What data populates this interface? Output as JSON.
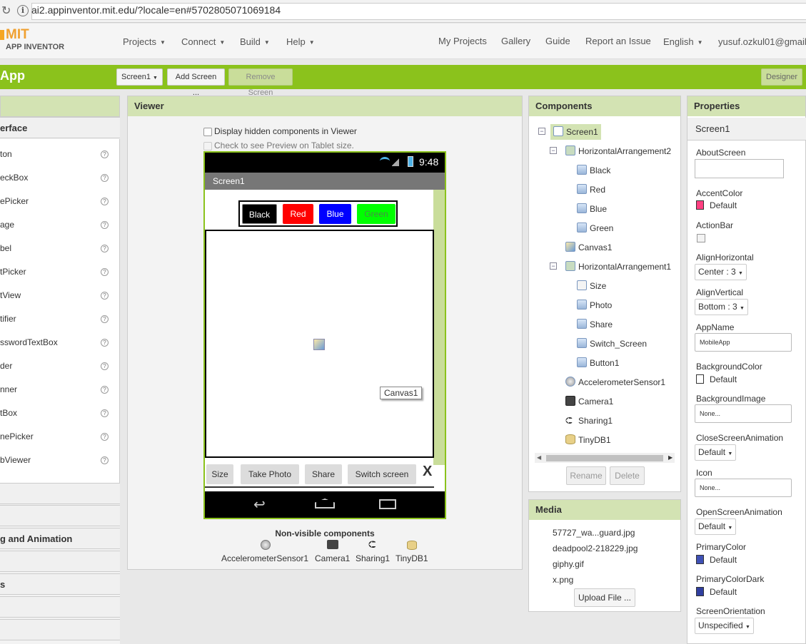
{
  "browser": {
    "url": "ai2.appinventor.mit.edu/?locale=en#5702805071069184"
  },
  "header": {
    "logo_mit": "MIT",
    "logo_sub": "APP INVENTOR",
    "menu_left": [
      "Projects",
      "Connect",
      "Build",
      "Help"
    ],
    "menu_right": [
      "My Projects",
      "Gallery",
      "Guide",
      "Report an Issue",
      "English",
      "yusuf.ozkul01@gmail."
    ]
  },
  "toolbar": {
    "app_title": "App",
    "screen_select": "Screen1",
    "add_screen": "Add Screen ...",
    "remove_screen": "Remove Screen",
    "designer": "Designer"
  },
  "palette": {
    "section_ui": "erface",
    "items": [
      "ton",
      "eckBox",
      "ePicker",
      "age",
      "bel",
      "tPicker",
      "tView",
      "tifier",
      "sswordTextBox",
      "der",
      "nner",
      "tBox",
      "nePicker",
      "bViewer"
    ],
    "section_drawing": "g and Animation",
    "section_other": "s"
  },
  "viewer": {
    "title": "Viewer",
    "display_hidden": "Display hidden components in Viewer",
    "tablet_preview": "Check to see Preview on Tablet size.",
    "phone": {
      "time": "9:48",
      "screen_title": "Screen1",
      "color_buttons": [
        "Black",
        "Red",
        "Blue",
        "Green"
      ],
      "canvas_tooltip": "Canvas1",
      "bottom_buttons": [
        "Size",
        "Take Photo",
        "Share",
        "Switch screen"
      ],
      "bottom_x": "X"
    },
    "nonvisible_title": "Non-visible components",
    "nonvisible": [
      "AccelerometerSensor1",
      "Camera1",
      "Sharing1",
      "TinyDB1"
    ]
  },
  "components": {
    "title": "Components",
    "tree": {
      "screen": "Screen1",
      "ha2": "HorizontalArrangement2",
      "ha2_children": [
        "Black",
        "Red",
        "Blue",
        "Green"
      ],
      "canvas": "Canvas1",
      "ha1": "HorizontalArrangement1",
      "ha1_children": [
        "Size",
        "Photo",
        "Share",
        "Switch_Screen",
        "Button1"
      ],
      "others": [
        "AccelerometerSensor1",
        "Camera1",
        "Sharing1",
        "TinyDB1"
      ]
    },
    "rename": "Rename",
    "delete": "Delete"
  },
  "media": {
    "title": "Media",
    "files": [
      "57727_wa...guard.jpg",
      "deadpool2-218229.jpg",
      "giphy.gif",
      "x.png"
    ],
    "upload": "Upload File ..."
  },
  "properties": {
    "title": "Properties",
    "component": "Screen1",
    "about_screen": "AboutScreen",
    "accent_color": "AccentColor",
    "accent_value": "Default",
    "action_bar": "ActionBar",
    "align_h": "AlignHorizontal",
    "align_h_value": "Center : 3",
    "align_v": "AlignVertical",
    "align_v_value": "Bottom : 3",
    "app_name": "AppName",
    "app_name_value": "MobileApp",
    "bg_color": "BackgroundColor",
    "bg_color_value": "Default",
    "bg_image": "BackgroundImage",
    "bg_image_value": "None...",
    "close_anim": "CloseScreenAnimation",
    "close_anim_value": "Default",
    "icon": "Icon",
    "icon_value": "None...",
    "open_anim": "OpenScreenAnimation",
    "open_anim_value": "Default",
    "primary_color": "PrimaryColor",
    "primary_color_value": "Default",
    "primary_dark": "PrimaryColorDark",
    "primary_dark_value": "Default",
    "orientation": "ScreenOrientation",
    "orientation_value": "Unspecified"
  },
  "colors": {
    "accent": "#8bc21c",
    "accent_swatch": "#ff4081",
    "primary_swatch": "#3f51b5",
    "primary_dark_swatch": "#303f9f"
  }
}
